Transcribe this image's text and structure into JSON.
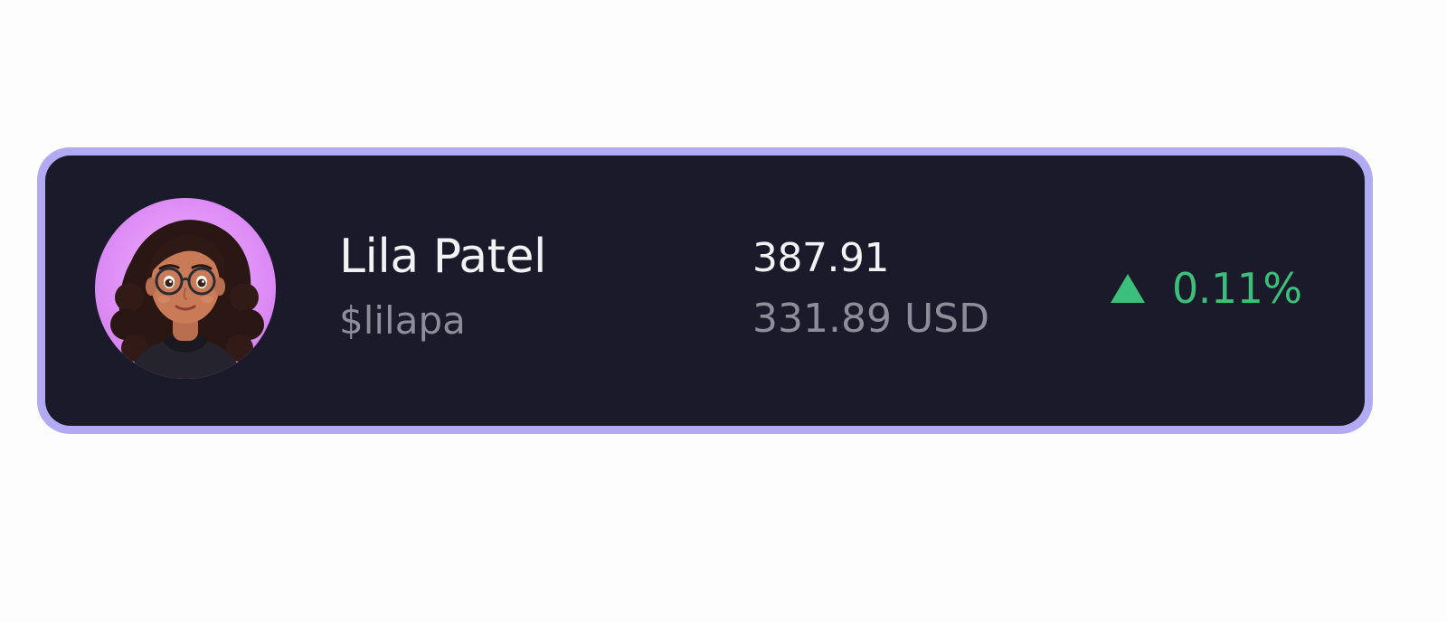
{
  "user": {
    "name": "Lila Patel",
    "handle": "$lilapa"
  },
  "balance": {
    "amount": "387.91",
    "fiat": "331.89 USD"
  },
  "change": {
    "direction": "up",
    "icon": "triangle-up-icon",
    "percent": "0.11%"
  },
  "colors": {
    "frame": "#b3aaf4",
    "card": "#1b1a2a",
    "positive": "#3cbf7a",
    "muted_text": "#8e8d99"
  }
}
